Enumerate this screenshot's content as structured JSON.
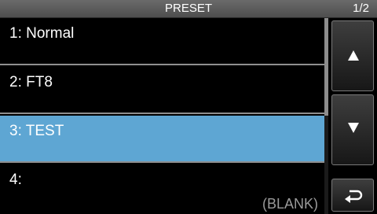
{
  "header": {
    "title": "PRESET",
    "page_indicator": "1/2"
  },
  "list": {
    "items": [
      {
        "label": "1: Normal",
        "sub": "",
        "selected": false
      },
      {
        "label": "2: FT8",
        "sub": "",
        "selected": false
      },
      {
        "label": "3: TEST",
        "sub": "",
        "selected": true
      },
      {
        "label": "4:",
        "sub": "(BLANK)",
        "selected": false
      }
    ]
  },
  "controls": {
    "up_icon": "triangle-up-icon",
    "down_icon": "triangle-down-icon",
    "back_icon": "return-arrow-icon"
  },
  "colors": {
    "selected_row": "#5ea6d3",
    "background": "#000000",
    "titlebar": "#5a5a5a",
    "blank_text": "#9a9a9a"
  }
}
